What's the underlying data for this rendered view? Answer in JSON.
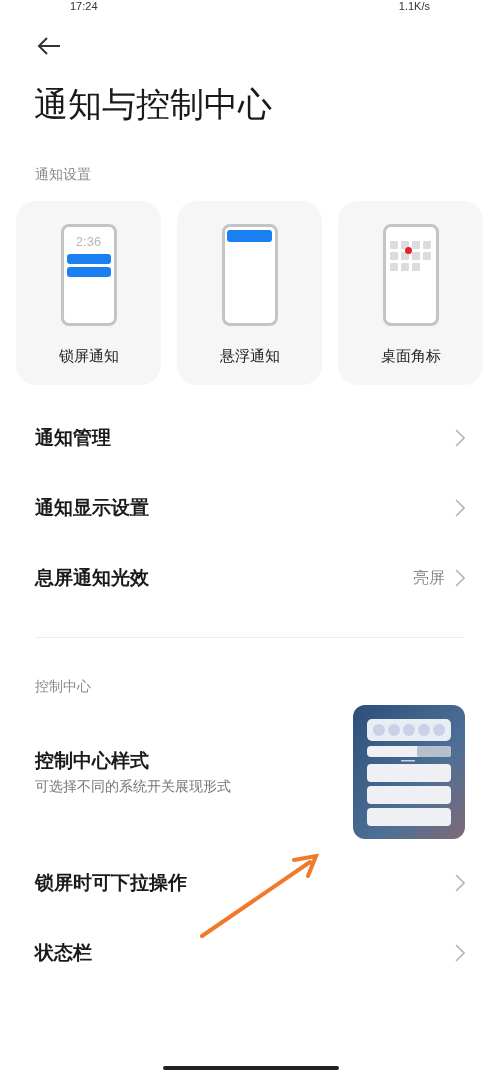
{
  "status_bar": {
    "time": "17:24",
    "speed": "1.1K/s"
  },
  "title": "通知与控制中心",
  "sections": [
    {
      "label": "通知设置",
      "cards": [
        {
          "kind": "lockscreen",
          "label": "锁屏通知",
          "clock": "2:36"
        },
        {
          "kind": "floating",
          "label": "悬浮通知"
        },
        {
          "kind": "badge",
          "label": "桌面角标"
        }
      ],
      "items": [
        {
          "kind": "link",
          "label": "通知管理"
        },
        {
          "kind": "link",
          "label": "通知显示设置"
        },
        {
          "kind": "link",
          "label": "息屏通知光效",
          "value": "亮屏"
        }
      ]
    },
    {
      "label": "控制中心",
      "items": [
        {
          "kind": "preview",
          "label": "控制中心样式",
          "subtitle": "可选择不同的系统开关展现形式"
        },
        {
          "kind": "link",
          "label": "锁屏时可下拉操作"
        },
        {
          "kind": "link",
          "label": "状态栏"
        }
      ]
    }
  ]
}
